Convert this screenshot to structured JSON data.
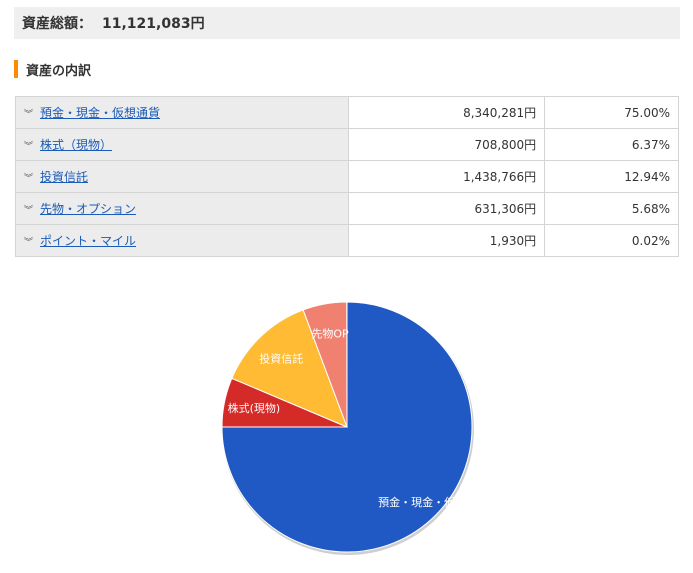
{
  "header": {
    "total_label": "資産総額：",
    "total_value": "11,121,083円"
  },
  "section": {
    "title": "資産の内訳"
  },
  "table": {
    "rows": [
      {
        "name": "預金・現金・仮想通貨",
        "amount": "8,340,281円",
        "percent": "75.00%"
      },
      {
        "name": "株式（現物）",
        "amount": "708,800円",
        "percent": "6.37%"
      },
      {
        "name": "投資信託",
        "amount": "1,438,766円",
        "percent": "12.94%"
      },
      {
        "name": "先物・オプション",
        "amount": "631,306円",
        "percent": "5.68%"
      },
      {
        "name": "ポイント・マイル",
        "amount": "1,930円",
        "percent": "0.02%"
      }
    ]
  },
  "chart_data": {
    "type": "pie",
    "slices": [
      {
        "label": "預金・現金・仮想",
        "value": 75.0,
        "color": "#2159c4"
      },
      {
        "label": "株式(現物)",
        "value": 6.37,
        "color": "#d42a28"
      },
      {
        "label": "投資信託",
        "value": 12.94,
        "color": "#ffbb33"
      },
      {
        "label": "先物OP",
        "value": 5.68,
        "color": "#f08070"
      },
      {
        "label": "",
        "value": 0.02,
        "color": "#2ca02c"
      }
    ],
    "start": "top",
    "direction": "clockwise"
  }
}
